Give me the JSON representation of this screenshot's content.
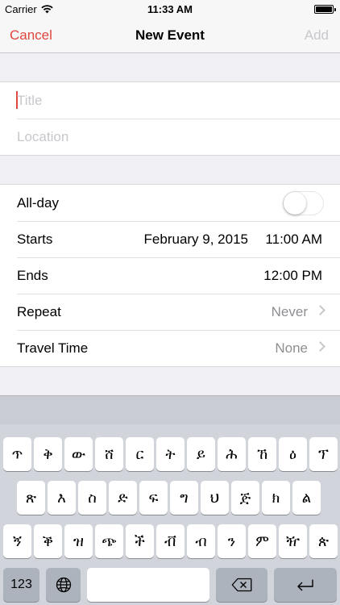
{
  "status_bar": {
    "carrier": "Carrier",
    "time": "11:33 AM"
  },
  "nav": {
    "cancel": "Cancel",
    "title": "New Event",
    "add": "Add"
  },
  "event": {
    "title_placeholder": "Title",
    "location_placeholder": "Location"
  },
  "details": {
    "allday_label": "All-day",
    "allday_on": false,
    "starts_label": "Starts",
    "starts_date": "February 9, 2015",
    "starts_time": "11:00 AM",
    "ends_label": "Ends",
    "ends_time": "12:00 PM",
    "repeat_label": "Repeat",
    "repeat_value": "Never",
    "travel_label": "Travel Time",
    "travel_value": "None"
  },
  "keyboard": {
    "row1": [
      "ጥ",
      "ቅ",
      "ው",
      "ሸ",
      "ር",
      "ት",
      "ይ",
      "ሕ",
      "ኸ",
      "ዕ",
      "ፕ"
    ],
    "row2": [
      "ጽ",
      "እ",
      "ስ",
      "ድ",
      "ፍ",
      "ግ",
      "ህ",
      "ጅ",
      "ክ",
      "ል"
    ],
    "row3": [
      "ኝ",
      "ቕ",
      "ዝ",
      "ጭ",
      "ች",
      "ቭ",
      "ብ",
      "ን",
      "ም",
      "ዥ",
      "ጵ"
    ],
    "numbers_label": "123"
  },
  "colors": {
    "accent": "#e0463d",
    "disabled": "#c7c7cc",
    "keyboard_bg": "#d1d5db"
  }
}
